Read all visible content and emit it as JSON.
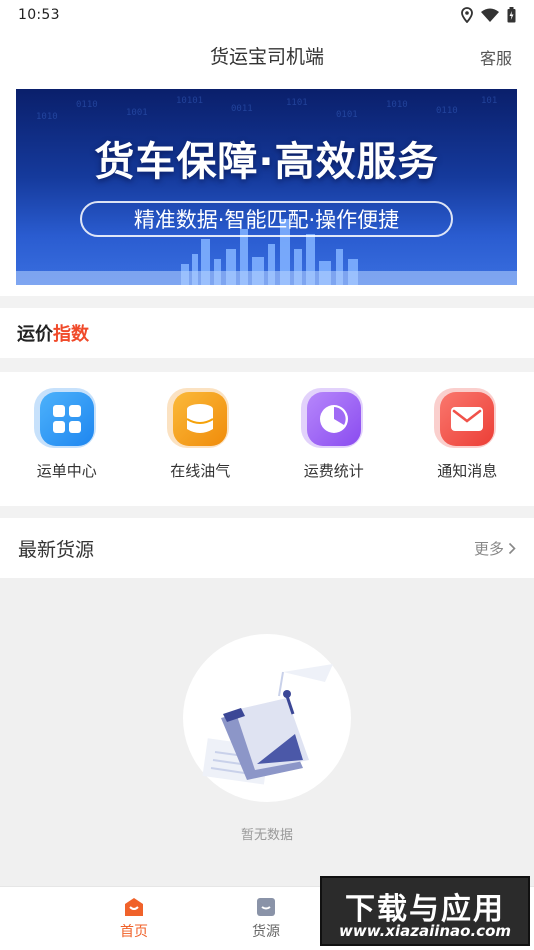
{
  "status_bar": {
    "time": "10:53"
  },
  "nav": {
    "title": "货运宝司机端",
    "right_label": "客服"
  },
  "banner": {
    "title": "货车保障·高效服务",
    "subtitle": "精准数据·智能匹配·操作便捷"
  },
  "index_section": {
    "title_part1": "运价",
    "title_part2": "指数"
  },
  "shortcuts": [
    {
      "label": "运单中心",
      "icon": "grid-icon",
      "color": "#2a9af5"
    },
    {
      "label": "在线油气",
      "icon": "database-icon",
      "color": "#f5a20a"
    },
    {
      "label": "运费统计",
      "icon": "pie-chart-icon",
      "color": "#9a5cf0"
    },
    {
      "label": "通知消息",
      "icon": "mail-icon",
      "color": "#f0524a"
    }
  ],
  "latest": {
    "title": "最新货源",
    "more_label": "更多"
  },
  "empty_state": {
    "text": "暂无数据"
  },
  "tabbar": {
    "items": [
      {
        "label": "首页",
        "icon": "home-icon",
        "active": true
      },
      {
        "label": "货源",
        "icon": "cargo-icon",
        "active": false
      }
    ]
  },
  "watermark": {
    "main": "下载与应用",
    "sub": "www.xiazaiinao.com"
  },
  "colors": {
    "accent": "#f0622a",
    "index_highlight": "#f04a2a"
  }
}
